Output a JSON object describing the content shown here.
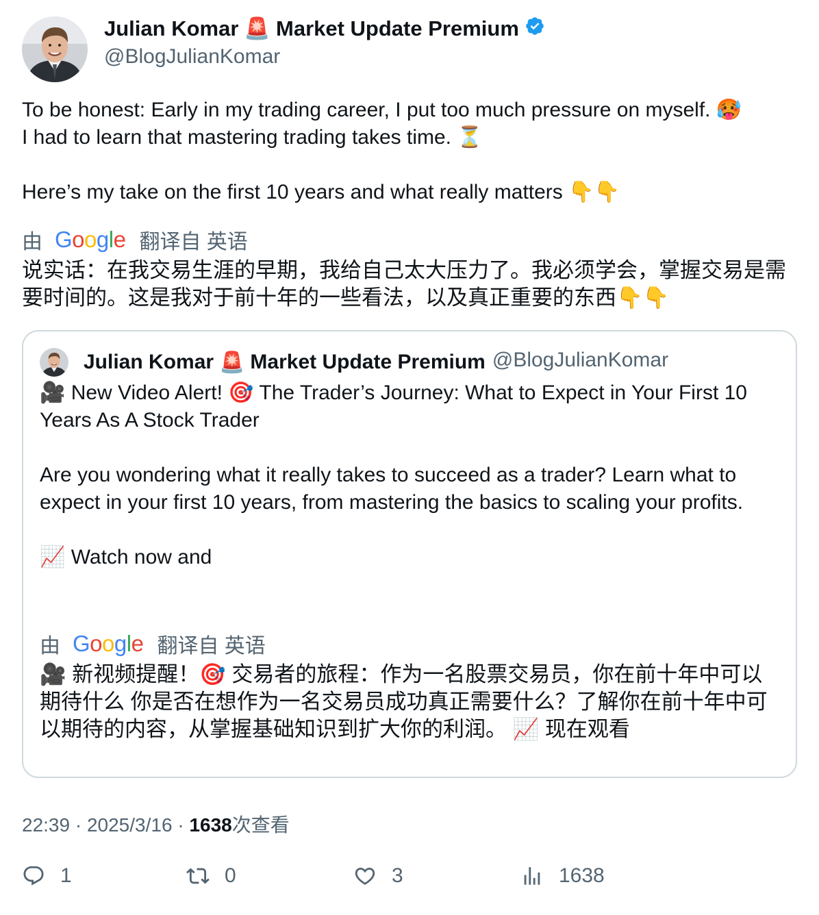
{
  "author": {
    "name": "Julian Komar",
    "siren": "🚨",
    "name_suffix": "Market Update Premium",
    "handle": "@BlogJulianKomar",
    "verified_icon": "verified-badge-icon",
    "verified_color": "#1d9bf0"
  },
  "tweet": {
    "text": "To be honest: Early in my trading career, I put too much pressure on myself. 🥵\nI had to learn that mastering trading takes time. ⏳\n\nHere’s my take on the first 10 years and what really matters 👇👇",
    "translation_by": "由",
    "translation_provider": "Google",
    "translation_from": "翻译自 英语",
    "translated_text": "说实话：在我交易生涯的早期，我给自己太大压力了。我必须学会，掌握交易是需要时间的。这是我对于前十年的一些看法，以及真正重要的东西👇👇"
  },
  "quoted": {
    "name": "Julian Komar",
    "siren": "🚨",
    "name_suffix": "Market Update Premium",
    "handle": "@BlogJulianKomar",
    "text": "🎥 New Video Alert! 🎯 The Trader’s Journey: What to Expect in Your First 10 Years As A Stock Trader\n\nAre you wondering what it really takes to succeed as a trader? Learn what to expect in your first 10 years, from mastering the basics to scaling your profits.\n\n📈 Watch now and",
    "translation_by": "由",
    "translation_provider": "Google",
    "translation_from": "翻译自 英语",
    "translated_text": "🎥 新视频提醒！🎯 交易者的旅程：作为一名股票交易员，你在前十年中可以期待什么 你是否在想作为一名交易员成功真正需要什么？了解你在前十年中可以期待的内容，从掌握基础知识到扩大你的利润。 📈 现在观看"
  },
  "meta": {
    "time": "22:39",
    "separator": "·",
    "date": "2025/3/16",
    "views_count": "1638",
    "views_label": "次查看"
  },
  "actions": {
    "reply_count": "1",
    "retweet_count": "0",
    "like_count": "3",
    "views_count": "1638"
  },
  "colors": {
    "text_primary": "#0f1419",
    "text_secondary": "#536471",
    "border": "#cfd9de",
    "google_blue": "#4285F4",
    "google_red": "#EA4335",
    "google_yellow": "#FBBC05",
    "google_green": "#34A853"
  }
}
